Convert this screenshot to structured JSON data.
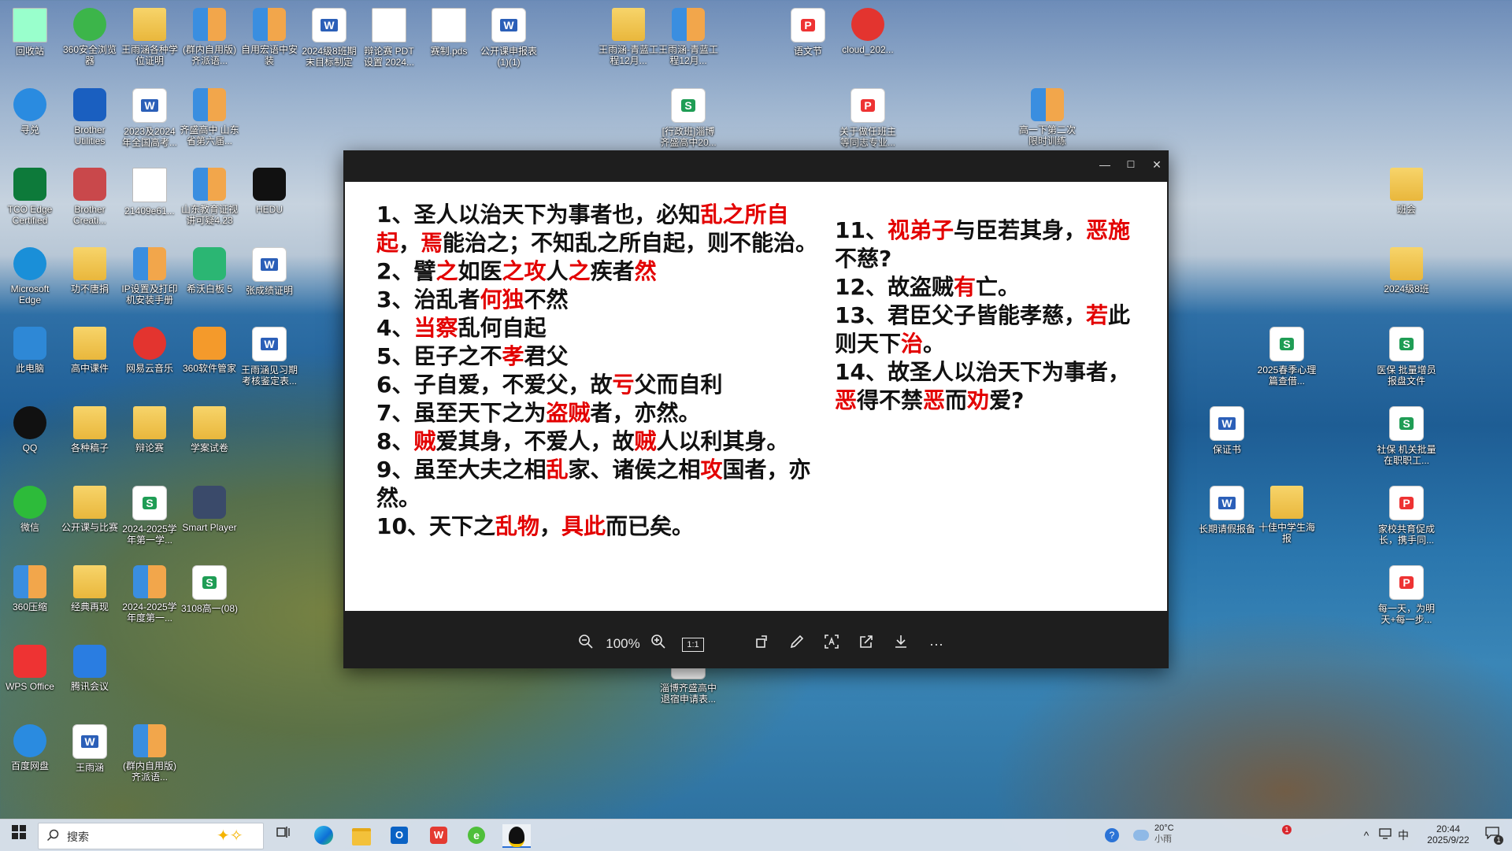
{
  "desktop_icons": [
    {
      "label": "回收站"
    },
    {
      "label": "360安全浏览器"
    },
    {
      "label": "王雨涵各种学位证明"
    },
    {
      "label": "(群内自用版) 齐派语..."
    },
    {
      "label": "自用宏语中安装"
    },
    {
      "label": "2024级8班期末目标制定"
    },
    {
      "label": "辩论赛 PDT 设置 2024..."
    },
    {
      "label": "赛制.pds"
    },
    {
      "label": "公开课申报表(1)(1)"
    },
    {
      "label": "王雨涵-青蓝工程12月..."
    },
    {
      "label": "王雨涵-青蓝工程12月..."
    },
    {
      "label": "语文节"
    },
    {
      "label": "cloud_202..."
    },
    {
      "label": "寻兑"
    },
    {
      "label": "Brother Utilities"
    },
    {
      "label": "2023及2024年全国高考..."
    },
    {
      "label": "齐盛高中 山东省第六届..."
    },
    {
      "label": "[行政班]淄博齐盛高中20..."
    },
    {
      "label": "关于做任班主等同志专业..."
    },
    {
      "label": "高一下第二次限时训练"
    },
    {
      "label": "TCO Edge Certified"
    },
    {
      "label": "Brother Creati..."
    },
    {
      "label": "21409e61..."
    },
    {
      "label": "山东教育证视讲可疑4.23"
    },
    {
      "label": "HEDU"
    },
    {
      "label": "班会"
    },
    {
      "label": "Microsoft Edge"
    },
    {
      "label": "功不唐捐"
    },
    {
      "label": "IP设置及打印机安装手册"
    },
    {
      "label": "希沃白板 5"
    },
    {
      "label": "张成绩证明"
    },
    {
      "label": "2024级8班"
    },
    {
      "label": "此电脑"
    },
    {
      "label": "高中课件"
    },
    {
      "label": "网易云音乐"
    },
    {
      "label": "360软件管家"
    },
    {
      "label": "王雨涵见习期考核鉴定表..."
    },
    {
      "label": "2025春季心理篇查借..."
    },
    {
      "label": "医保 批量增员报盘文件"
    },
    {
      "label": "QQ"
    },
    {
      "label": "各种稿子"
    },
    {
      "label": "辩论赛"
    },
    {
      "label": "学案试卷"
    },
    {
      "label": "保证书"
    },
    {
      "label": "社保 机关批量在职职工..."
    },
    {
      "label": "微信"
    },
    {
      "label": "公开课与比赛"
    },
    {
      "label": "2024-2025学年第一学..."
    },
    {
      "label": "Smart Player"
    },
    {
      "label": "长期请假报备"
    },
    {
      "label": "十佳中学生海报"
    },
    {
      "label": "家校共育促成长，携手同..."
    },
    {
      "label": "360压缩"
    },
    {
      "label": "经典再现"
    },
    {
      "label": "2024-2025学年度第一..."
    },
    {
      "label": "3108高一(08)"
    },
    {
      "label": "每一天，为明天+每一步..."
    },
    {
      "label": "WPS Office"
    },
    {
      "label": "腾讯会议"
    },
    {
      "label": "淄博齐盛高中退宿申请表..."
    },
    {
      "label": "百度网盘"
    },
    {
      "label": "王雨涵"
    },
    {
      "label": "(群内自用版) 齐派语..."
    }
  ],
  "viewer": {
    "left_lines": [
      [
        [
          "1、圣人以治天下为事者也，必知",
          0
        ],
        [
          "乱之所自起",
          1
        ],
        [
          "，",
          0
        ],
        [
          "焉",
          1
        ],
        [
          "能治之；不知乱之所自起，则不能治。",
          0
        ]
      ],
      [
        [
          "2、譬",
          0
        ],
        [
          "之",
          1
        ],
        [
          "如医",
          0
        ],
        [
          "之攻",
          1
        ],
        [
          "人",
          0
        ],
        [
          "之",
          1
        ],
        [
          "疾者",
          0
        ],
        [
          "然",
          1
        ]
      ],
      [
        [
          "3、治乱者",
          0
        ],
        [
          "何独",
          1
        ],
        [
          "不然",
          0
        ]
      ],
      [
        [
          "4、",
          0
        ],
        [
          "当察",
          1
        ],
        [
          "乱何自起",
          0
        ]
      ],
      [
        [
          "5、臣子之不",
          0
        ],
        [
          "孝",
          1
        ],
        [
          "君父",
          0
        ]
      ],
      [
        [
          "6、子自爱，不爱父，故",
          0
        ],
        [
          "亏",
          1
        ],
        [
          "父而自利",
          0
        ]
      ],
      [
        [
          "7、虽至天下之为",
          0
        ],
        [
          "盗贼",
          1
        ],
        [
          "者，亦然。",
          0
        ]
      ],
      [
        [
          "8、",
          0
        ],
        [
          "贼",
          1
        ],
        [
          "爱其身，不爱人，故",
          0
        ],
        [
          "贼",
          1
        ],
        [
          "人以利其身。",
          0
        ]
      ],
      [
        [
          "9、虽至大夫之相",
          0
        ],
        [
          "乱",
          1
        ],
        [
          "家、诸侯之相",
          0
        ],
        [
          "攻",
          1
        ],
        [
          "国者，亦然。",
          0
        ]
      ],
      [
        [
          "10、天下之",
          0
        ],
        [
          "乱物",
          1
        ],
        [
          "，",
          0
        ],
        [
          "具此",
          1
        ],
        [
          "而已矣。",
          0
        ]
      ]
    ],
    "right_lines": [
      [
        [
          "11、",
          0
        ],
        [
          "视弟子",
          1
        ],
        [
          "与臣若其身，",
          0
        ],
        [
          "恶施",
          1
        ],
        [
          "不慈?",
          0
        ]
      ],
      [
        [
          "12、故盗贼",
          0
        ],
        [
          "有",
          1
        ],
        [
          "亡。",
          0
        ]
      ],
      [
        [
          "13、君臣父子皆能孝慈，",
          0
        ],
        [
          "若",
          1
        ],
        [
          "此则天下",
          0
        ],
        [
          "治",
          1
        ],
        [
          "。",
          0
        ]
      ],
      [
        [
          "14、故圣人以治天下为事者，",
          0
        ],
        [
          "恶",
          1
        ],
        [
          "得不禁",
          0
        ],
        [
          "恶",
          1
        ],
        [
          "而",
          0
        ],
        [
          "劝",
          1
        ],
        [
          "爱?",
          0
        ]
      ]
    ],
    "toolbar": {
      "zoom": "100%",
      "actual_size": "1:1",
      "more": "···"
    },
    "window_controls": {
      "minimize": "—",
      "maximize": "☐",
      "close": "✕"
    }
  },
  "taskbar": {
    "search_placeholder": "搜索",
    "weather_temp": "20°C",
    "weather_desc": "小雨",
    "ime": "中",
    "time": "20:44",
    "date": "2025/9/22",
    "notification_count": "1",
    "badge": "1"
  },
  "colors": {
    "highlight": "#e30000"
  }
}
